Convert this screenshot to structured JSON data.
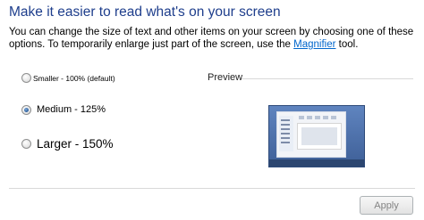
{
  "page": {
    "title": "Make it easier to read what's on your screen",
    "description_prefix": "You can change the size of text and other items on your screen by choosing one of these options. To temporarily enlarge just part of the screen, use the ",
    "description_link": "Magnifier",
    "description_suffix": " tool."
  },
  "options": [
    {
      "label": "Smaller - 100% (default)",
      "checked": false
    },
    {
      "label": "Medium - 125%",
      "checked": true
    },
    {
      "label": "Larger - 150%",
      "checked": false
    }
  ],
  "preview": {
    "label": "Preview"
  },
  "buttons": {
    "apply": "Apply",
    "apply_enabled": false
  },
  "colors": {
    "title": "#1e3e8c",
    "link": "#0066cc",
    "preview_bg": "#4a6fab"
  },
  "icons": {
    "preview_image": "desktop-preview-thumbnail"
  }
}
